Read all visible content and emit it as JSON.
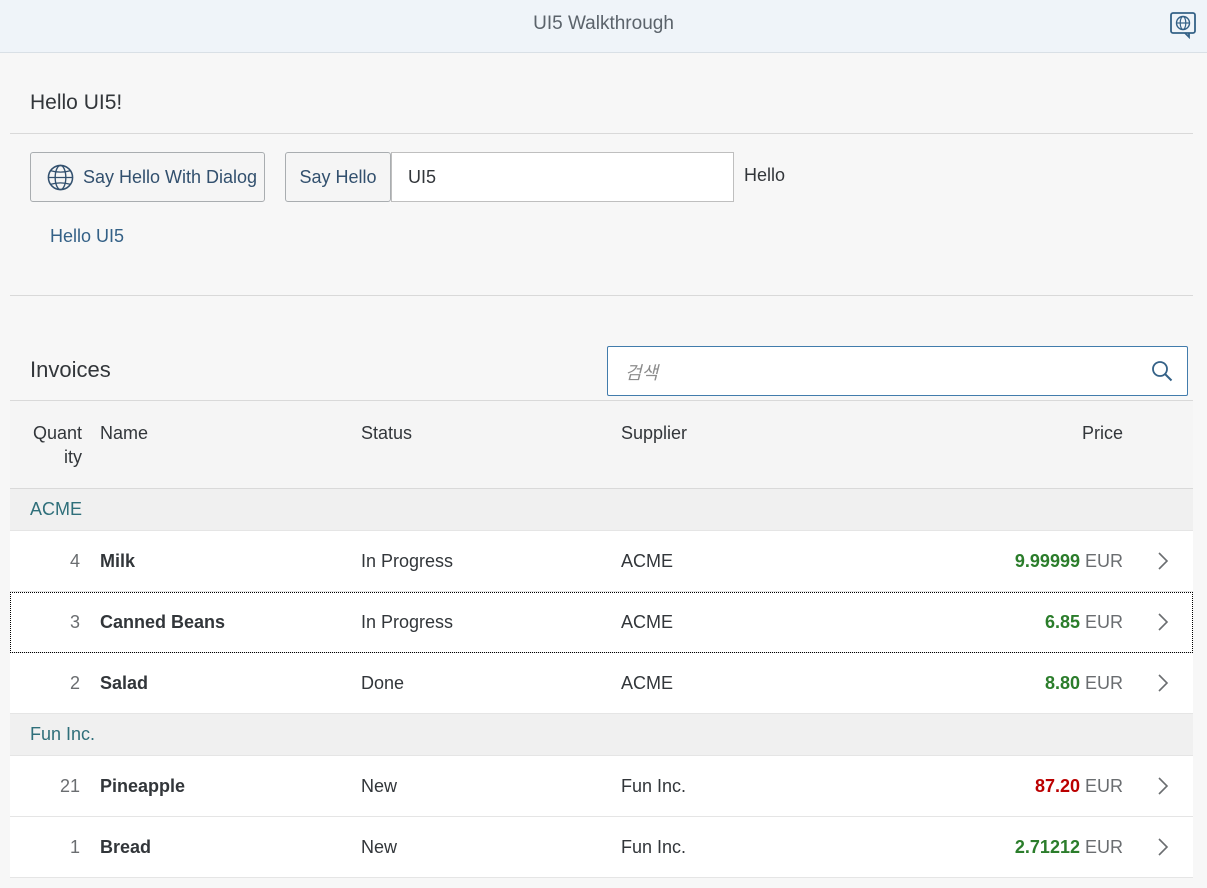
{
  "shell": {
    "title": "UI5 Walkthrough",
    "help_icon": "globe-help-icon"
  },
  "panel": {
    "title": "Hello UI5!"
  },
  "buttons": {
    "dialog_label": "Say Hello With Dialog",
    "dialog_icon": "globe-icon",
    "hello_label": "Say Hello"
  },
  "name_input": {
    "value": "UI5"
  },
  "hello_text": "Hello",
  "hello_link": "Hello UI5",
  "invoices": {
    "title": "Invoices",
    "search_placeholder": "검색",
    "columns": {
      "quantity": "Quantity",
      "name": "Name",
      "status": "Status",
      "supplier": "Supplier",
      "price": "Price"
    },
    "currency": "EUR",
    "colors": {
      "good": "#2b7d2b",
      "bad": "#bb0000",
      "group": "#2f6f7a"
    },
    "groups": [
      {
        "label": "ACME",
        "rows": [
          {
            "quantity": "4",
            "name": "Milk",
            "status": "In Progress",
            "supplier": "ACME",
            "price": "9.99999",
            "price_state": "good"
          },
          {
            "quantity": "3",
            "name": "Canned Beans",
            "status": "In Progress",
            "supplier": "ACME",
            "price": "6.85",
            "price_state": "good"
          },
          {
            "quantity": "2",
            "name": "Salad",
            "status": "Done",
            "supplier": "ACME",
            "price": "8.80",
            "price_state": "good"
          }
        ]
      },
      {
        "label": "Fun Inc.",
        "rows": [
          {
            "quantity": "21",
            "name": "Pineapple",
            "status": "New",
            "supplier": "Fun Inc.",
            "price": "87.20",
            "price_state": "bad"
          },
          {
            "quantity": "1",
            "name": "Bread",
            "status": "New",
            "supplier": "Fun Inc.",
            "price": "2.71212",
            "price_state": "good"
          }
        ]
      }
    ]
  }
}
